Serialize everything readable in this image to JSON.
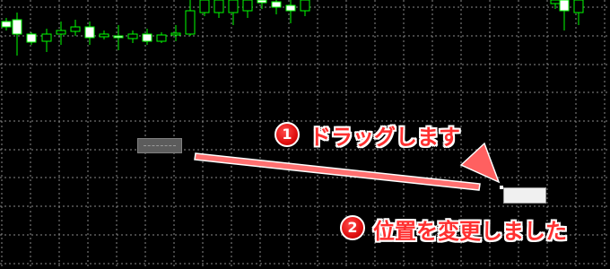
{
  "chart": {
    "up_candle_fill": "#ffffff",
    "down_candle_fill": "#000000",
    "candle_outline": "#00ff00",
    "grid_color": "#8a8a8a",
    "background": "#000000"
  },
  "annotations": {
    "step1": {
      "number": "1",
      "text": "ドラッグします"
    },
    "step2": {
      "number": "2",
      "text": "位置を変更しました"
    },
    "accent_color": "#ff3030"
  },
  "objects": {
    "original": {
      "state": "before-drag"
    },
    "moved": {
      "state": "after-drag"
    }
  }
}
